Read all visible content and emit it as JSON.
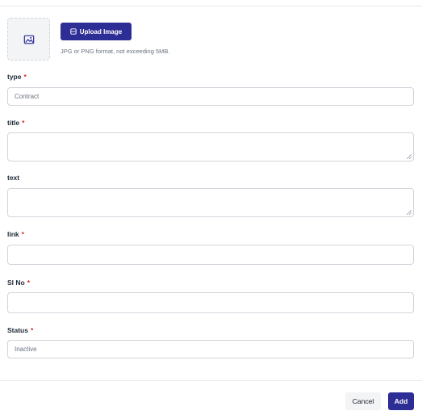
{
  "upload": {
    "button_label": "Upload Image",
    "hint": "JPG or PNG format, not exceeding 5MB."
  },
  "form": {
    "type": {
      "label": "type",
      "required_mark": "*",
      "placeholder": "Contract"
    },
    "title": {
      "label": "title",
      "required_mark": "*",
      "value": ""
    },
    "text": {
      "label": "text",
      "value": ""
    },
    "link": {
      "label": "link",
      "required_mark": "*",
      "value": ""
    },
    "sl_no": {
      "label": "Sl No",
      "required_mark": "*",
      "value": ""
    },
    "status": {
      "label": "Status",
      "required_mark": "*",
      "placeholder": "Inactive"
    }
  },
  "footer": {
    "cancel_label": "Cancel",
    "add_label": "Add"
  },
  "colors": {
    "primary": "#2d2d96",
    "required": "#dc2626",
    "border": "#d1d5db"
  },
  "icons": {
    "image_placeholder": "image-icon",
    "upload": "upload-icon"
  }
}
